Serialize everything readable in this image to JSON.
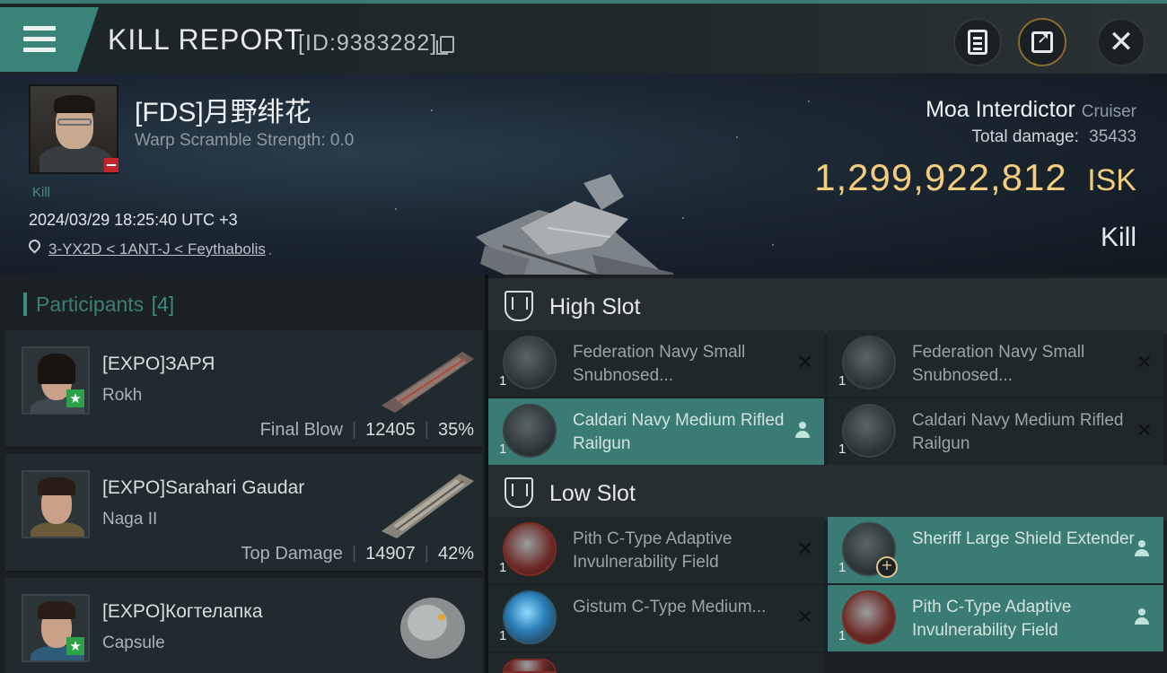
{
  "header": {
    "title": "KILL REPORT",
    "report_id": "[ID:9383282]"
  },
  "victim": {
    "name": "[FDS]月野绯花",
    "warp_scramble": "Warp Scramble Strength: 0.0",
    "tag": "Kill",
    "datetime": "2024/03/29 18:25:40 UTC +3",
    "location": "3-YX2D < 1ANT-J < Feythabolis",
    "ship_name": "Moa Interdictor",
    "ship_class": "Cruiser",
    "total_damage_label": "Total damage:",
    "total_damage": "35433",
    "isk_value": "1,299,922,812",
    "isk_unit": "ISK",
    "result": "Kill"
  },
  "participants": {
    "title": "Participants",
    "count": "[4]",
    "list": [
      {
        "name": "[EXPO]ЗАРЯ",
        "ship": "Rokh",
        "role": "Final Blow",
        "damage": "12405",
        "percent": "35%"
      },
      {
        "name": "[EXPO]Sarahari Gaudar",
        "ship": "Naga II",
        "role": "Top Damage",
        "damage": "14907",
        "percent": "42%"
      },
      {
        "name": "[EXPO]Когтелапка",
        "ship": "Capsule"
      }
    ]
  },
  "fitting": {
    "high_slot_title": "High Slot",
    "low_slot_title": "Low Slot",
    "high": [
      {
        "qty": "1",
        "name": "Federation Navy Small Snubnosed...",
        "state": "destroyed"
      },
      {
        "qty": "1",
        "name": "Federation Navy Small Snubnosed...",
        "state": "destroyed"
      },
      {
        "qty": "1",
        "name": "Caldari Navy Medium Rifled Railgun",
        "state": "dropped"
      },
      {
        "qty": "1",
        "name": "Caldari Navy Medium Rifled Railgun",
        "state": "destroyed"
      }
    ],
    "low": [
      {
        "qty": "1",
        "name": "Pith C-Type Adaptive Invulnerability Field",
        "state": "destroyed"
      },
      {
        "qty": "1",
        "name": "Sheriff Large Shield Extender",
        "state": "dropped"
      },
      {
        "qty": "1",
        "name": "Gistum C-Type Medium...",
        "state": "destroyed"
      },
      {
        "qty": "1",
        "name": "Pith C-Type Adaptive Invulnerability Field",
        "state": "dropped"
      }
    ]
  },
  "colors": {
    "accent": "#3a8378",
    "isk": "#f2cd7d",
    "dropped": "#3a7c73"
  }
}
